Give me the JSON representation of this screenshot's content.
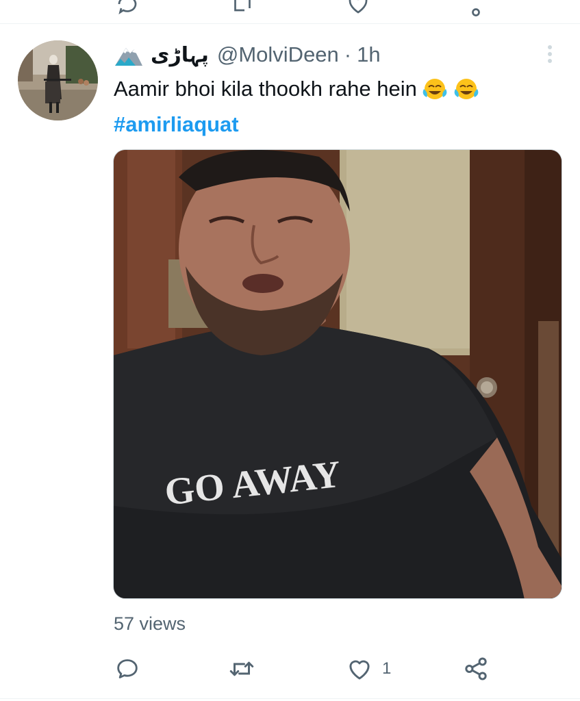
{
  "tweet": {
    "display_name": "پہاڑی",
    "handle": "@MolviDeen",
    "separator": "·",
    "time": "1h",
    "text": "Aamir bhoi kila thookh rahe hein",
    "text_emojis": [
      "face-with-tears-of-joy",
      "face-with-tears-of-joy"
    ],
    "hashtag": "#amirliaquat",
    "media": {
      "shirt_text": "GO AWAY"
    },
    "views": "57 views",
    "actions": {
      "reply_count": "",
      "retweet_count": "",
      "like_count": "1"
    }
  },
  "colors": {
    "link": "#1d9bf0",
    "secondary_text": "#536471",
    "divider": "#eff3f4"
  },
  "icons": {
    "reply": "reply-icon",
    "retweet": "retweet-icon",
    "like": "heart-icon",
    "share": "share-icon",
    "more": "more-options-icon",
    "badge": "snowy-mountain-icon"
  }
}
